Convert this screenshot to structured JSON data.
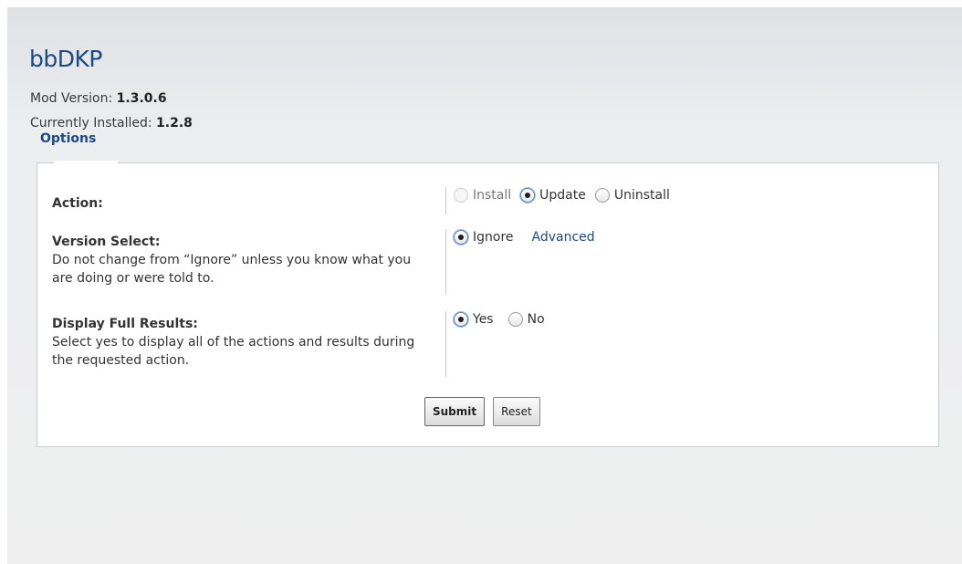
{
  "header": {
    "title": "bbDKP",
    "mod_version_label": "Mod Version:",
    "mod_version": "1.3.0.6",
    "installed_label": "Currently Installed:",
    "installed_version": "1.2.8",
    "options_tab": "Options"
  },
  "form": {
    "action": {
      "label": "Action:",
      "options": [
        "Install",
        "Update",
        "Uninstall"
      ],
      "selected": "Update",
      "disabled": [
        "Install"
      ]
    },
    "version_select": {
      "label": "Version Select:",
      "help": "Do not change from “Ignore” unless you know what you are doing or were told to.",
      "option": "Ignore",
      "link": "Advanced"
    },
    "full_results": {
      "label": "Display Full Results:",
      "help": "Select yes to display all of the actions and results during the requested action.",
      "options": [
        "Yes",
        "No"
      ],
      "selected": "Yes"
    },
    "buttons": {
      "submit": "Submit",
      "reset": "Reset"
    }
  }
}
